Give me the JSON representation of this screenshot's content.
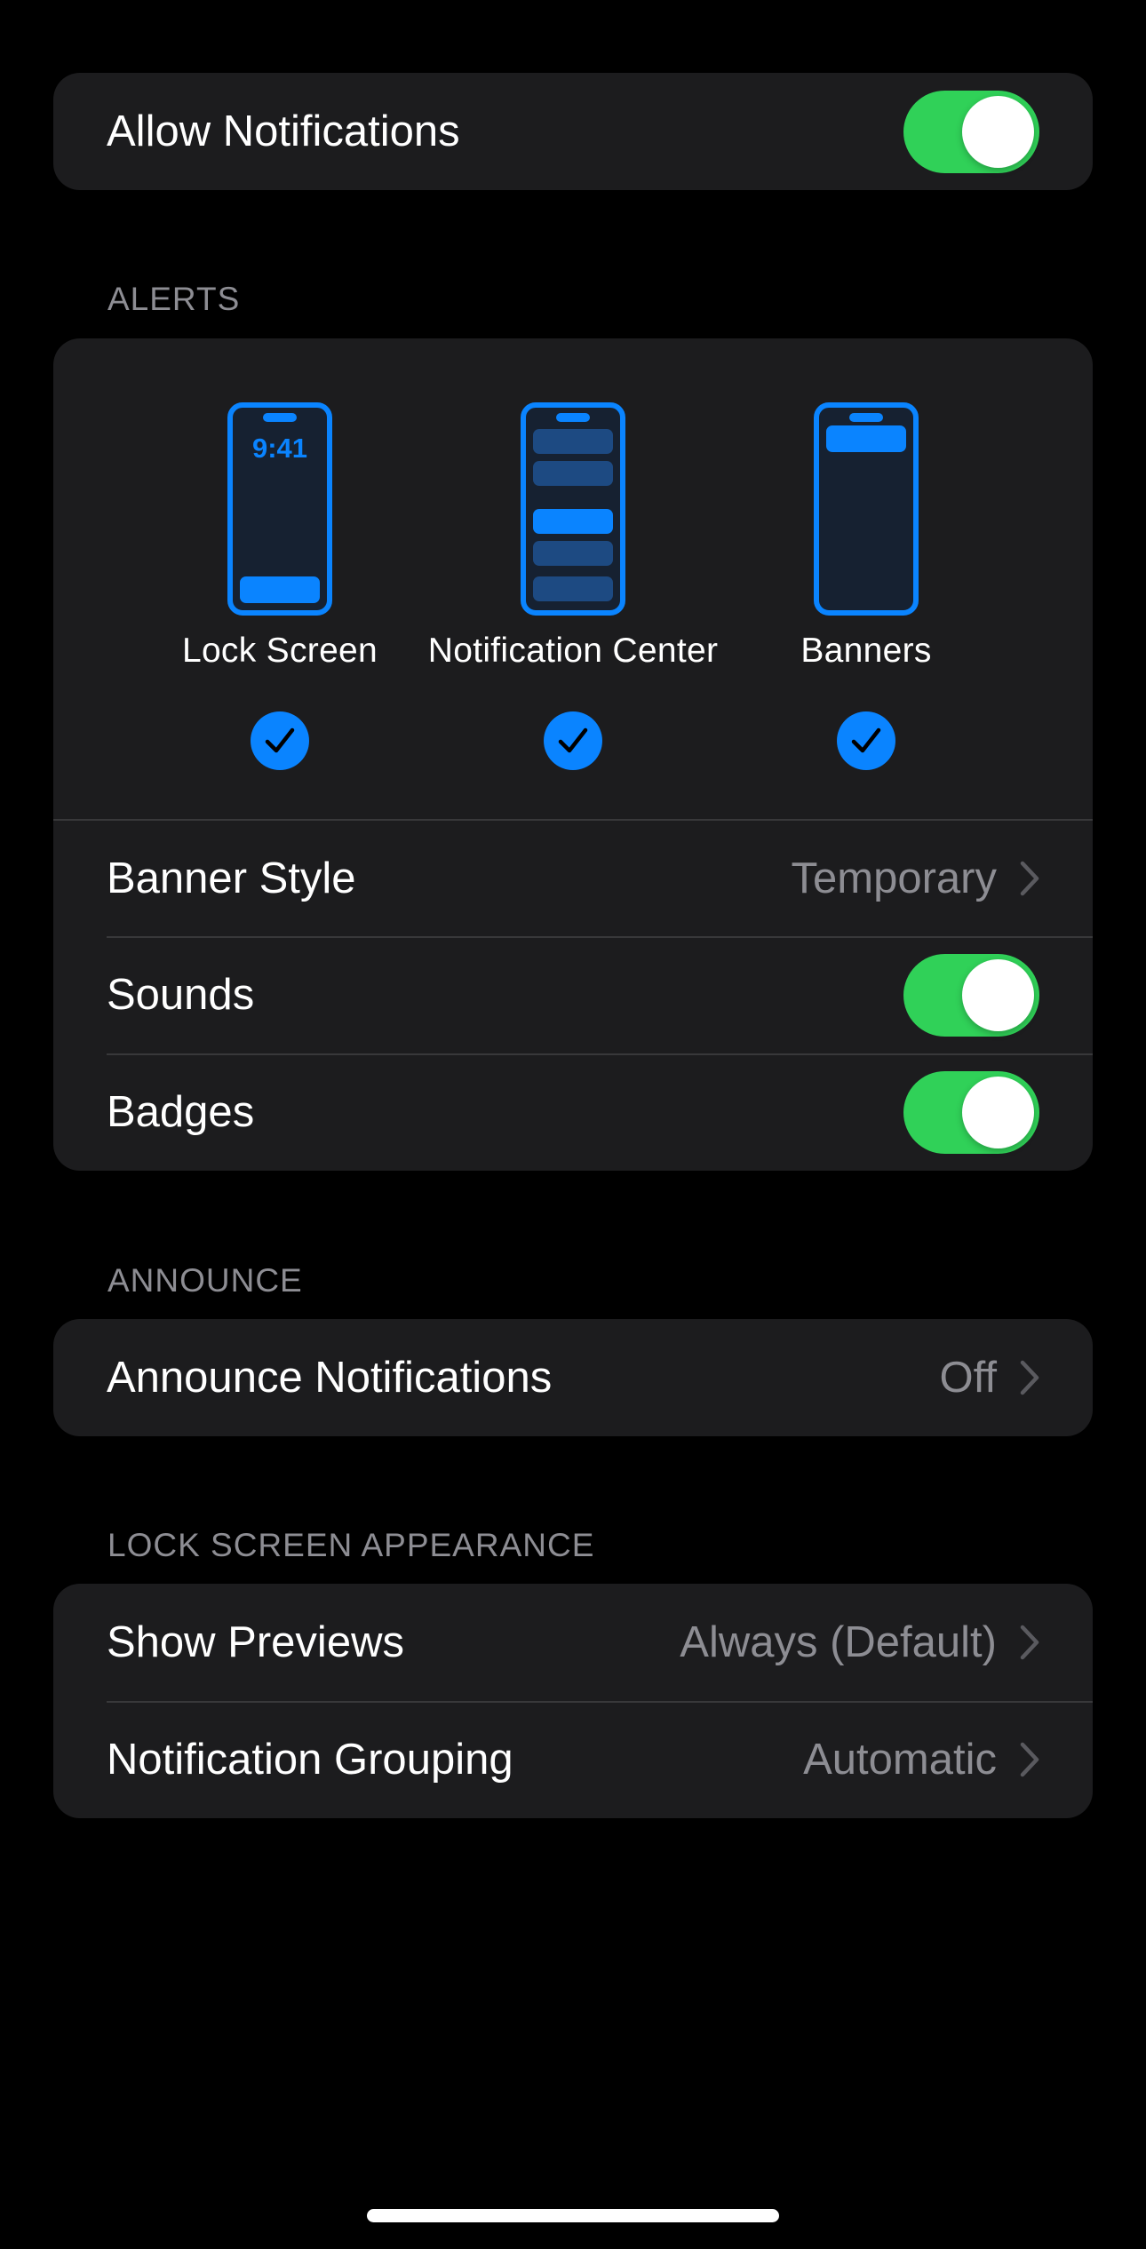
{
  "allow_notifications": {
    "label": "Allow Notifications",
    "on": true
  },
  "alerts": {
    "header": "ALERTS",
    "options": [
      {
        "label": "Lock Screen",
        "time": "9:41",
        "checked": true
      },
      {
        "label": "Notification Center",
        "checked": true
      },
      {
        "label": "Banners",
        "checked": true
      }
    ],
    "banner_style": {
      "label": "Banner Style",
      "value": "Temporary"
    },
    "sounds": {
      "label": "Sounds",
      "on": true
    },
    "badges": {
      "label": "Badges",
      "on": true
    }
  },
  "announce": {
    "header": "ANNOUNCE",
    "announce_notifications": {
      "label": "Announce Notifications",
      "value": "Off"
    }
  },
  "lock_screen_appearance": {
    "header": "LOCK SCREEN APPEARANCE",
    "show_previews": {
      "label": "Show Previews",
      "value": "Always (Default)"
    },
    "notification_grouping": {
      "label": "Notification Grouping",
      "value": "Automatic"
    }
  },
  "colors": {
    "accent": "#0a84ff",
    "toggle_on": "#30d158",
    "background": "#000000",
    "cell": "#1c1c1e",
    "secondary_text": "#8d8d93"
  }
}
